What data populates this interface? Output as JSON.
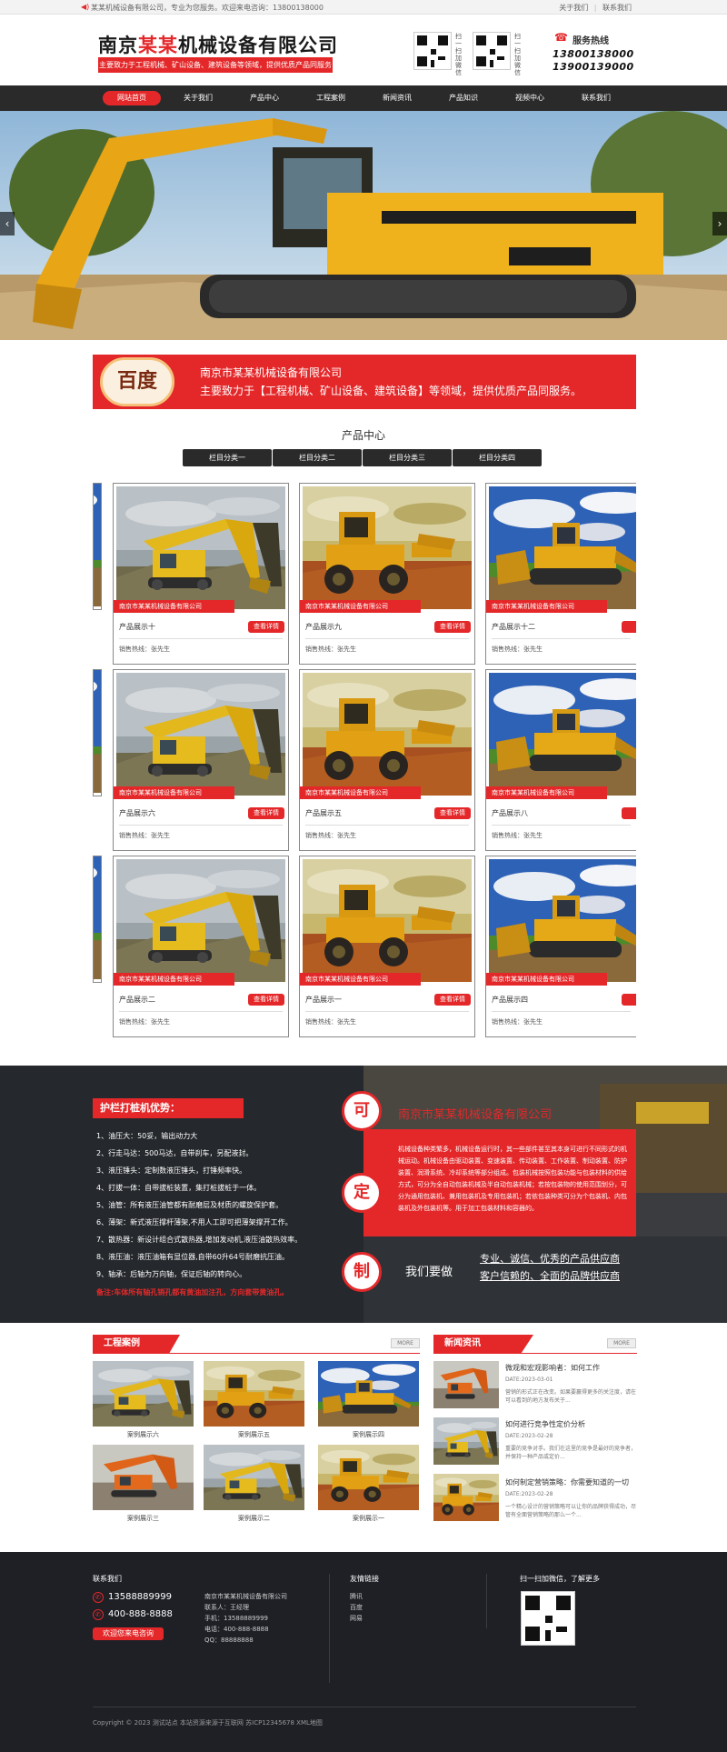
{
  "topbar": {
    "left_text": "某某机械设备有限公司，专业为您服务。欢迎来电咨询：13800138000",
    "right_about": "关于我们",
    "right_contact": "联系我们"
  },
  "header": {
    "logo_part1": "南京",
    "logo_part2": "某某",
    "logo_part3": "机械设备有限公司",
    "subtitle": "主要致力于工程机械、矿山设备、建筑设备等领域，提供优质产品同服务",
    "qr1_caption": "扫一扫加微信",
    "qr2_caption": "扫一扫加微信",
    "hotline_label": "服务热线",
    "hotline_1": "13800138000",
    "hotline_2": "13900139000"
  },
  "nav": {
    "items": [
      "网站首页",
      "关于我们",
      "产品中心",
      "工程案例",
      "新闻资讯",
      "产品知识",
      "视频中心",
      "联系我们"
    ]
  },
  "banner": {
    "prev": "‹",
    "next": "›"
  },
  "intro": {
    "badge": "百度",
    "company": "南京市某某机械设备有限公司",
    "desc": "主要致力于【工程机械、矿山设备、建筑设备】等领域，提供优质产品同服务。"
  },
  "products": {
    "title": "产品中心",
    "tabs": [
      "栏目分类一",
      "栏目分类二",
      "栏目分类三",
      "栏目分类四"
    ],
    "company_tag": "南京市某某机械设备有限公司",
    "detail_btn": "查看详情",
    "sales_line": "销售热线：张先生",
    "rows": [
      [
        "产品展示十",
        "产品展示九",
        "产品展示十二"
      ],
      [
        "产品展示六",
        "产品展示五",
        "产品展示八"
      ],
      [
        "产品展示二",
        "产品展示一",
        "产品展示四"
      ]
    ]
  },
  "advantages": {
    "heading": "护栏打桩机优势：",
    "items": [
      "1、油压大：50妥，输出动力大",
      "2、行走马达：500马达，自带刹车，另配液封。",
      "3、液压锤头：定制数液压锤头，打锤频率快。",
      "4、打拔一体：自带拔桩装置，集打桩拔桩于一体。",
      "5、油管：所有液压油管都有耐磨层及材质的螺旋保护套。",
      "6、薄架：新式液压撑杆薄架,不用人工即可把薄架撑开工作。",
      "7、散热器：新设计组合式散热器,增加发动机,液压油散热效率。",
      "8、液压油：液压油箱有显位器,自带60升64号耐磨抗压油。",
      "9、轴承：后轴为万向轴，保证后轴的转向心。"
    ],
    "note": "备注:车体所有轴孔销孔都有黄油加注孔，方向套带黄油孔。",
    "circles": [
      "可",
      "定",
      "制"
    ],
    "company": "南京市某某机械设备有限公司",
    "paragraph": "机械设备种类繁多，机械设备运行时，其一些部件甚至其本身可进行不同形式的机械运动。机械设备由驱动装置、变速装置、传动装置、工作装置、制动装置、防护装置、润滑系统、冷却系统等部分组成。包装机械按照包装功能与包装材料的供给方式，可分为全自动包装机械及半自动包装机械；若按包装物的使用范围划分，可分为通用包装机、兼用包装机及专用包装机；若依包装种类可分为个包装机、内包装机及外包装机等。用于加工包装材料和容器的。",
    "we_do": "我们要做",
    "mission_1": "专业、诚信、优秀的产品供应商",
    "mission_2": "客户信赖的、全面的品牌供应商"
  },
  "cases": {
    "title": "工程案例",
    "more": "MORE",
    "items": [
      "案例展示六",
      "案例展示五",
      "案例展示四",
      "案例展示三",
      "案例展示二",
      "案例展示一"
    ]
  },
  "news": {
    "title": "新闻资讯",
    "more": "MORE",
    "items": [
      {
        "title": "微观和宏观影响者：如何工作",
        "date": "DATE:2023-03-01",
        "summary": "营销的形式正在改变。如果要赢得更多的关注度，请在可以看到的地方发布关于..."
      },
      {
        "title": "如何进行竞争性定价分析",
        "date": "DATE:2023-02-28",
        "summary": "重要的竞争对手。我们在这里的竞争是最好的竞争者，并保持一种产品或定价..."
      },
      {
        "title": "如何制定营销策略：你需要知道的一切",
        "date": "DATE:2023-02-28",
        "summary": "一个精心设计的营销策略可以让你的品牌获得成功，尽管有全面营销策略的那么一个..."
      }
    ]
  },
  "footer": {
    "contact_title": "联系我们",
    "phone_1": "13588889999",
    "phone_2": "400-888-8888",
    "consult_btn": "欢迎您来电咨询",
    "info": [
      "南京市某某机械设备有限公司",
      "联系人：王经理",
      "手机：13588889999",
      "电话：400-888-8888",
      "QQ：88888888"
    ],
    "links_title": "友情链接",
    "links": [
      "腾讯",
      "百度",
      "网易"
    ],
    "qr_title": "扫一扫加微信，了解更多",
    "copyright": "Copyright © 2023 测试站点 本站资源来源于互联网 苏ICP12345678 XML地图"
  },
  "colors": {
    "accent": "#e4282a",
    "dark_nav": "#2a2a2a",
    "footer_bg": "#1e2026"
  }
}
